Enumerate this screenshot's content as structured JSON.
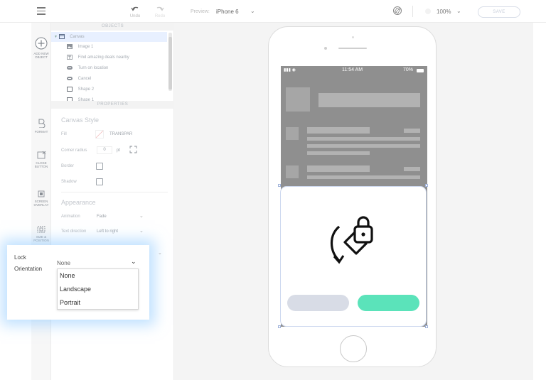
{
  "toolbar": {
    "undo_label": "Undo",
    "redo_label": "Redo",
    "preview_label": "Preview:",
    "preview_device": "iPhone 6",
    "zoom": "100%",
    "save_label": "SAVE"
  },
  "sidebar": {
    "add_new_object": "ADD NEW OBJECT",
    "items": [
      {
        "label": "FORMAT",
        "icon": "format-icon"
      },
      {
        "label": "CLOSE BUTTON",
        "icon": "close-button-icon"
      },
      {
        "label": "SCREEN OVERLAY",
        "icon": "screen-overlay-icon"
      },
      {
        "label": "SIZE & POSITION",
        "icon": "size-position-icon"
      }
    ]
  },
  "objects": {
    "header": "OBJECTS",
    "items": [
      {
        "label": "Canvas",
        "icon": "canvas-icon"
      },
      {
        "label": "Image 1",
        "icon": "image-icon"
      },
      {
        "label": "Find amazing deals nearby",
        "icon": "text-icon"
      },
      {
        "label": "Turn on location",
        "icon": "button-icon"
      },
      {
        "label": "Cancel",
        "icon": "button-icon"
      },
      {
        "label": "Shape 2",
        "icon": "shape-icon"
      },
      {
        "label": "Shape 1",
        "icon": "shape-icon"
      }
    ]
  },
  "properties": {
    "header": "PROPERTIES",
    "canvas_style_title": "Canvas Style",
    "fill_label": "Fill",
    "fill_value": "TRANSPAR",
    "corner_radius_label": "Corner radius",
    "corner_radius_value": "0",
    "corner_radius_unit": "pt",
    "border_label": "Border",
    "shadow_label": "Shadow",
    "appearance_title": "Appearance",
    "animation_label": "Animation",
    "animation_value": "Fade",
    "text_direction_label": "Text direction",
    "text_direction_value": "Left to right"
  },
  "phone": {
    "time": "11:54 AM",
    "battery": "70%"
  },
  "lock_orientation": {
    "label_line1": "Lock",
    "label_line2": "Orientation",
    "selected": "None",
    "options": [
      "None",
      "Landscape",
      "Portrait"
    ]
  },
  "colors": {
    "accent_green": "#5be3ba",
    "secondary_button": "#d8dce6",
    "selection_highlight": "#e8f0ff"
  }
}
